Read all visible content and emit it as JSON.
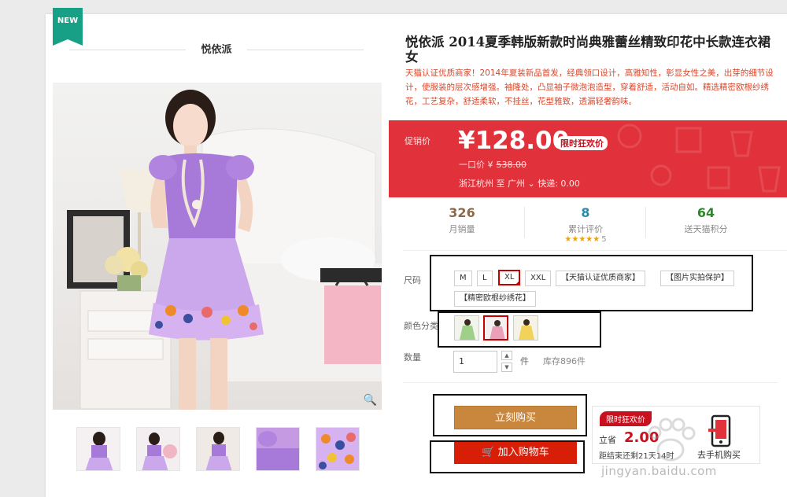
{
  "badge": "NEW",
  "shop_name": "悦依派",
  "product": {
    "title": "悦依派 2014夏季韩版新款时尚典雅蕾丝精致印花中长款连衣裙 女",
    "description": "天猫认证优质商家！2014年夏装新品首发，经典领口设计，高雅知性，彰显女性之美，出芽的细节设计，使服装的层次感增强。袖隆处，凸显袖子微泡泡造型，穿着舒适，活动自如。精选精密欧根纱绣花，工艺复杂，舒适柔软，不挂丝，花型雅致，透漏轻奢韵味。"
  },
  "price": {
    "label": "促销价",
    "value": "¥128.00",
    "tag": "限时狂欢价",
    "original_label": "一口价 ¥",
    "original_value": "538.00",
    "ship_from": "浙江杭州",
    "ship_to_word": "至",
    "ship_to": "广州",
    "ship_chevron": "⌄",
    "ship_fee": "快递: 0.00"
  },
  "stats": [
    {
      "num": "326",
      "label": "月销量",
      "color": "#8a6a4a"
    },
    {
      "num": "8",
      "label": "累计评价",
      "color": "#2a8aa8",
      "stars": "★★★★★",
      "rating": "5"
    },
    {
      "num": "64",
      "label": "送天猫积分",
      "color": "#2a8a2a"
    }
  ],
  "size": {
    "label": "尺码",
    "options": [
      "M",
      "L",
      "XL",
      "XXL",
      "【天猫认证优质商家】",
      "【图片实拍保护】",
      "【精密欧根纱绣花】"
    ],
    "selected": "XL"
  },
  "color": {
    "label": "颜色分类",
    "swatches": [
      "green-dress",
      "pink-dress",
      "yellow-dress"
    ],
    "selected_index": 1
  },
  "quantity": {
    "label": "数量",
    "value": "1",
    "unit": "件",
    "stock": "库存896件",
    "up": "▲",
    "down": "▼"
  },
  "buttons": {
    "buy": "立刻购买",
    "cart": "加入购物车"
  },
  "promo": {
    "tag": "限时狂欢价",
    "text": "立省",
    "price": "2.00",
    "sub": "距结束还剩21天14时"
  },
  "mobile": {
    "label": "去手机购买"
  },
  "watermark": "jingyan.baidu.com",
  "colors": {
    "accent_red": "#e1313a",
    "buy_button": "#c8873c",
    "cart_button": "#d81e06",
    "badge_green": "#17a085"
  }
}
